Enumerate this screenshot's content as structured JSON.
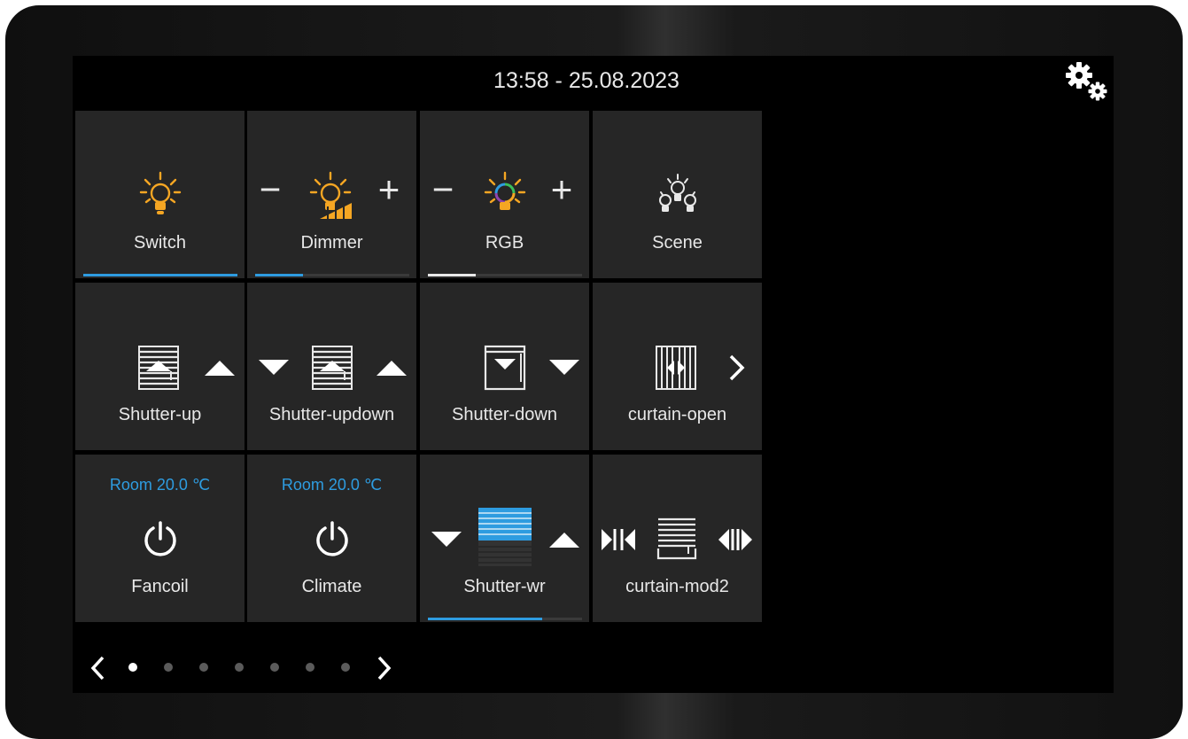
{
  "header": {
    "datetime": "13:58 - 25.08.2023",
    "settings_icon": "gears-icon"
  },
  "colors": {
    "bulb": "#f5a623",
    "accent": "#2e9ce0",
    "tile": "#262626"
  },
  "tiles": [
    {
      "label": "Switch",
      "icon": "bulb-icon",
      "level": 1.0
    },
    {
      "label": "Dimmer",
      "icon": "dimmer-bulb-icon",
      "minus": "−",
      "plus": "+",
      "level": 0.31
    },
    {
      "label": "RGB",
      "icon": "rgb-bulb-icon",
      "minus": "−",
      "plus": "+",
      "level": 0.31
    },
    {
      "label": "Scene",
      "icon": "scene-bulbs-icon"
    },
    {
      "label": "Shutter-up",
      "icon": "shutter-up-icon"
    },
    {
      "label": "Shutter-updown",
      "icon": "shutter-updown-icon"
    },
    {
      "label": "Shutter-down",
      "icon": "shutter-down-icon"
    },
    {
      "label": "curtain-open",
      "icon": "curtain-open-icon"
    },
    {
      "label": "Fancoil",
      "icon": "power-icon",
      "temp": "Room 20.0 ℃"
    },
    {
      "label": "Climate",
      "icon": "power-icon",
      "temp": "Room 20.0 ℃"
    },
    {
      "label": "Shutter-wr",
      "icon": "shutter-level-icon",
      "level": 0.74,
      "blind_level": 0.56
    },
    {
      "label": "curtain-mod2",
      "icon": "curtain-mod2-icon"
    }
  ],
  "pager": {
    "pages": 7,
    "current": 1
  }
}
